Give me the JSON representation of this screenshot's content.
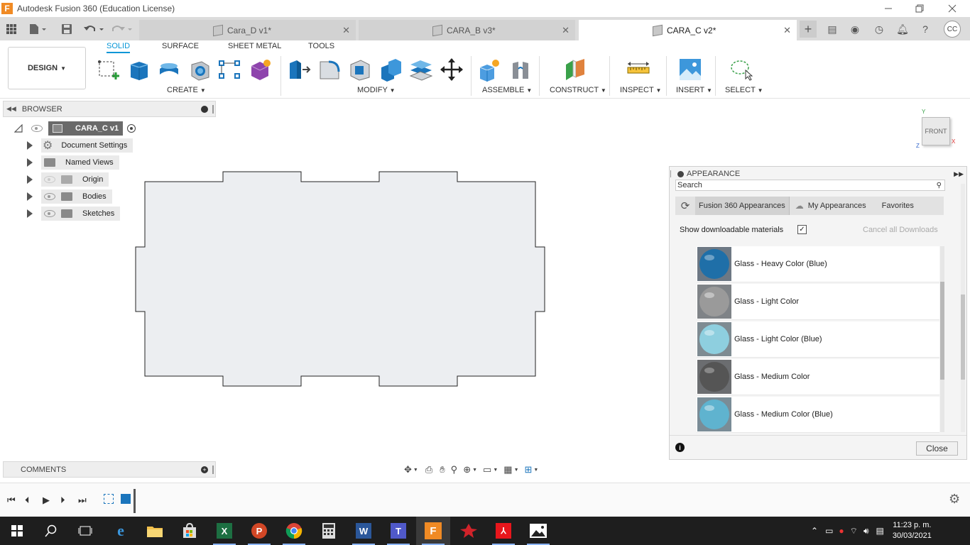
{
  "window": {
    "title": "Autodesk Fusion 360 (Education License)",
    "app_icon": "F",
    "minimize_icon": "minimize-icon",
    "maximize_icon": "restore-icon",
    "close_icon": "close-icon"
  },
  "tabs": [
    {
      "label": "Cara_D v1*",
      "active": false
    },
    {
      "label": "CARA_B v3*",
      "active": false
    },
    {
      "label": "CARA_C v2*",
      "active": true
    }
  ],
  "user": {
    "initials": "CC"
  },
  "toolbar": {
    "workspace": "DESIGN",
    "workspace_tabs": [
      "SOLID",
      "SURFACE",
      "SHEET METAL",
      "TOOLS"
    ],
    "groups": {
      "create": "CREATE",
      "modify": "MODIFY",
      "assemble": "ASSEMBLE",
      "construct": "CONSTRUCT",
      "inspect": "INSPECT",
      "insert": "INSERT",
      "select": "SELECT"
    }
  },
  "browser": {
    "title": "BROWSER",
    "root": "CARA_C v1",
    "items": [
      {
        "label": "Document Settings",
        "icon": "gear-icon"
      },
      {
        "label": "Named Views",
        "icon": "folder-icon"
      },
      {
        "label": "Origin",
        "icon": "folder-icon"
      },
      {
        "label": "Bodies",
        "icon": "folder-icon"
      },
      {
        "label": "Sketches",
        "icon": "folder-icon"
      }
    ]
  },
  "viewcube": {
    "face": "FRONT",
    "axis_y": "Y",
    "axis_x": "X",
    "axis_z": "Z"
  },
  "appearance": {
    "title": "APPEARANCE",
    "search_placeholder": "Search",
    "tabs": [
      "Fusion 360 Appearances",
      "My Appearances",
      "Favorites"
    ],
    "show_downloadable_label": "Show downloadable materials",
    "show_downloadable_checked": true,
    "cancel_downloads": "Cancel all Downloads",
    "materials": [
      {
        "name": "Glass - Heavy Color (Blue)",
        "color": "#1f6fa8"
      },
      {
        "name": "Glass - Light Color",
        "color": "#9a9a9a"
      },
      {
        "name": "Glass - Light Color (Blue)",
        "color": "#8ecfdf"
      },
      {
        "name": "Glass - Medium Color",
        "color": "#555555"
      },
      {
        "name": "Glass - Medium Color (Blue)",
        "color": "#5fb3cf"
      }
    ],
    "close_label": "Close"
  },
  "comments": {
    "title": "COMMENTS"
  },
  "taskbar": {
    "time": "11:23 p. m.",
    "date": "30/03/2021"
  },
  "colors": {
    "accent": "#0696d7",
    "sketch_fill": "#eceef1",
    "taskbar": "#1e1e1e"
  }
}
